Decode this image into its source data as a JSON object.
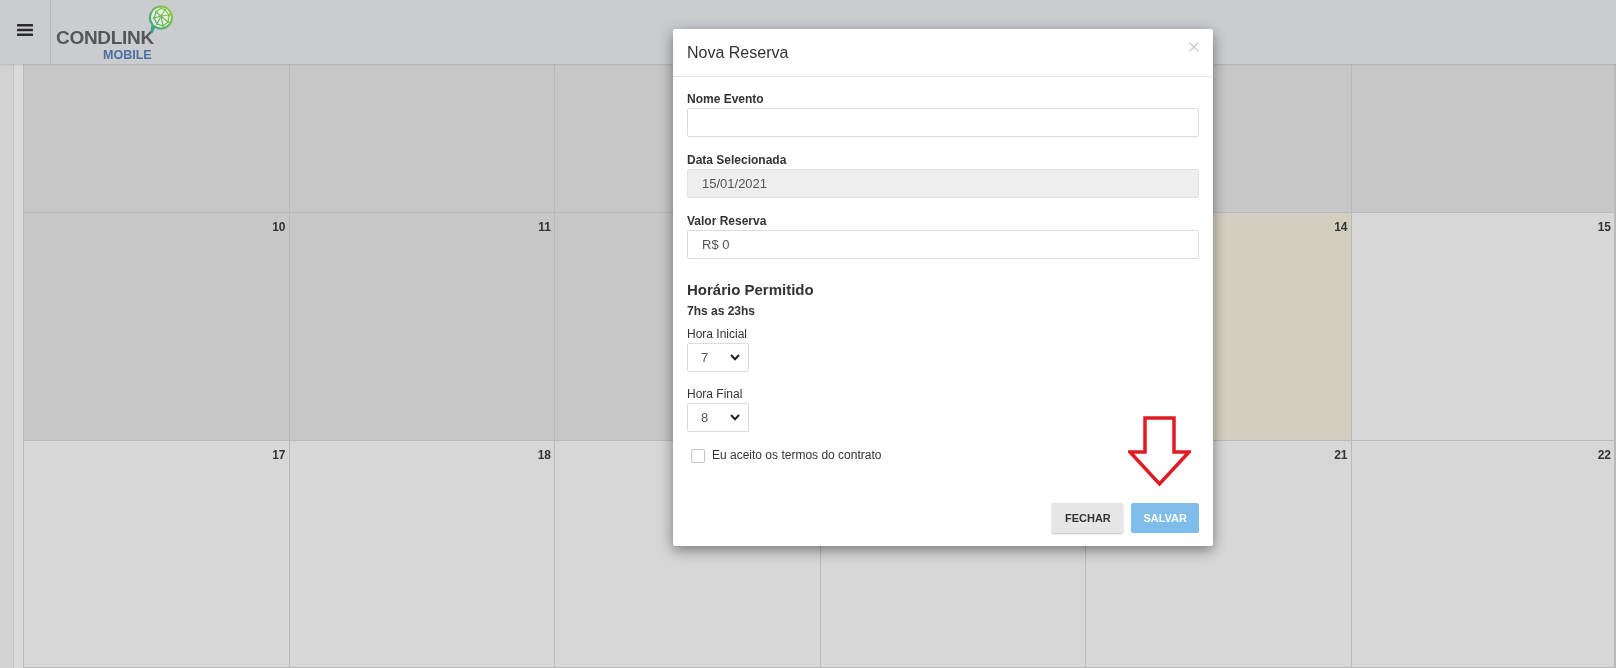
{
  "header": {
    "logo": {
      "wordmark": "CONDLINK",
      "tagline": "MOBILE"
    }
  },
  "calendar": {
    "weeks": [
      {
        "days": [
          {
            "today": false
          },
          {
            "today": false
          },
          {
            "today": false
          },
          {
            "today": false
          },
          {
            "today": false
          }
        ]
      },
      {
        "days": [
          {
            "label": "10",
            "today": false
          },
          {
            "label": "11",
            "today": false
          },
          {
            "today": false
          },
          {
            "label": "14",
            "today": true
          },
          {
            "label": "15",
            "today": false
          }
        ]
      },
      {
        "days": [
          {
            "label": "17",
            "today": false
          },
          {
            "label": "18",
            "today": false
          },
          {
            "today": false
          },
          {
            "today": false
          },
          {
            "label": "21",
            "today": false
          },
          {
            "label": "22",
            "today": false
          }
        ]
      }
    ]
  },
  "dialog": {
    "title": "Nova Reserva",
    "fields": [
      {
        "label": "Nome Evento",
        "disabled": false
      },
      {
        "label": "Data Selecionada",
        "value": "15/01/2021",
        "disabled": true
      },
      {
        "label": "Valor Reserva",
        "value": "R$ 0",
        "disabled": false
      }
    ],
    "schedule": {
      "title": "Horário Permitido",
      "note": "7hs as 23hs",
      "selects": [
        {
          "label": "Hora Inicial",
          "value": "7"
        },
        {
          "label": "Hora Final",
          "value": "8"
        }
      ]
    },
    "agreement": {
      "label": "Eu aceito os termos do contrato",
      "checked": false
    },
    "buttons": [
      {
        "label": "FECHAR",
        "kind": "secondary",
        "disabled": false
      },
      {
        "label": "SALVAR",
        "kind": "primary",
        "disabled": true
      }
    ]
  }
}
